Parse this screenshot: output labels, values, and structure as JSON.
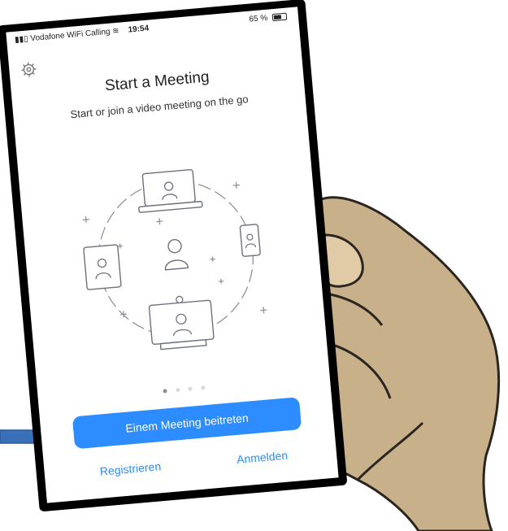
{
  "status_bar": {
    "carrier": "Vodafone WiFi Calling",
    "time": "19:54",
    "battery": "65 %"
  },
  "header": {
    "title": "Start a Meeting",
    "subtitle": "Start or join a video meeting on the go"
  },
  "carousel": {
    "page_count": 4,
    "active_page": 1
  },
  "actions": {
    "join_label": "Einem Meeting beitreten",
    "register_label": "Registrieren",
    "login_label": "Anmelden"
  },
  "colors": {
    "accent": "#2d8cff",
    "skin": "#c7b08a",
    "arrow": "#3a70b8"
  },
  "icons": [
    "gear-icon",
    "wifi-icon",
    "battery-icon",
    "arrow-icon"
  ]
}
